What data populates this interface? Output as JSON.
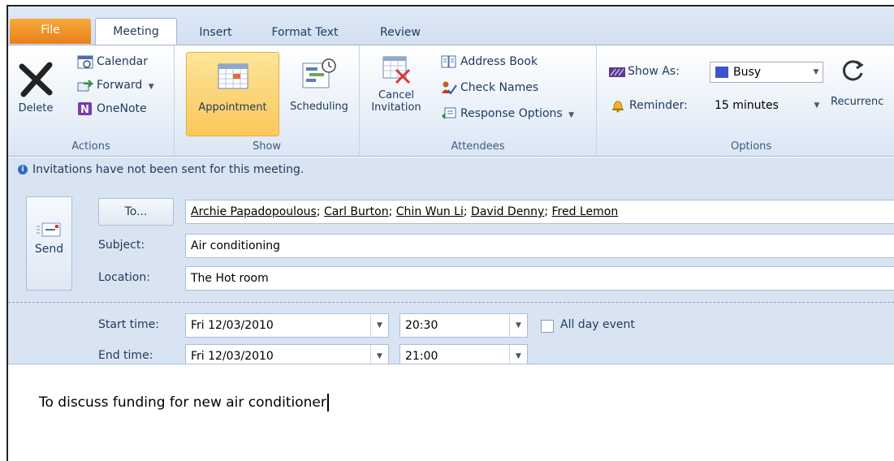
{
  "tabs": {
    "file": "File",
    "meeting": "Meeting",
    "insert": "Insert",
    "format_text": "Format Text",
    "review": "Review"
  },
  "ribbon": {
    "actions": {
      "label": "Actions",
      "delete": "Delete",
      "calendar": "Calendar",
      "forward": "Forward",
      "onenote": "OneNote"
    },
    "show": {
      "label": "Show",
      "appointment": "Appointment",
      "scheduling": "Scheduling"
    },
    "attendees": {
      "label": "Attendees",
      "cancel_line1": "Cancel",
      "cancel_line2": "Invitation",
      "address_book": "Address Book",
      "check_names": "Check Names",
      "response_options": "Response Options"
    },
    "options": {
      "label": "Options",
      "show_as_label": "Show As:",
      "show_as_value": "Busy",
      "reminder_label": "Reminder:",
      "reminder_value": "15 minutes",
      "recurrence": "Recurrenc"
    }
  },
  "infobar": {
    "message": "Invitations have not been sent for this meeting."
  },
  "form": {
    "send": "Send",
    "to_button": "To...",
    "recipients": [
      "Archie Papadopoulous",
      "Carl Burton",
      "Chin Wun Li",
      "David Denny",
      "Fred Lemon"
    ],
    "subject_label": "Subject:",
    "subject_value": "Air conditioning",
    "location_label": "Location:",
    "location_value": "The Hot room",
    "start_label": "Start time:",
    "start_date": "Fri 12/03/2010",
    "start_time": "20:30",
    "end_label": "End time:",
    "end_date": "Fri 12/03/2010",
    "end_time": "21:00",
    "all_day_label": "All day event"
  },
  "body": {
    "text": "To discuss funding for new air conditioner"
  }
}
